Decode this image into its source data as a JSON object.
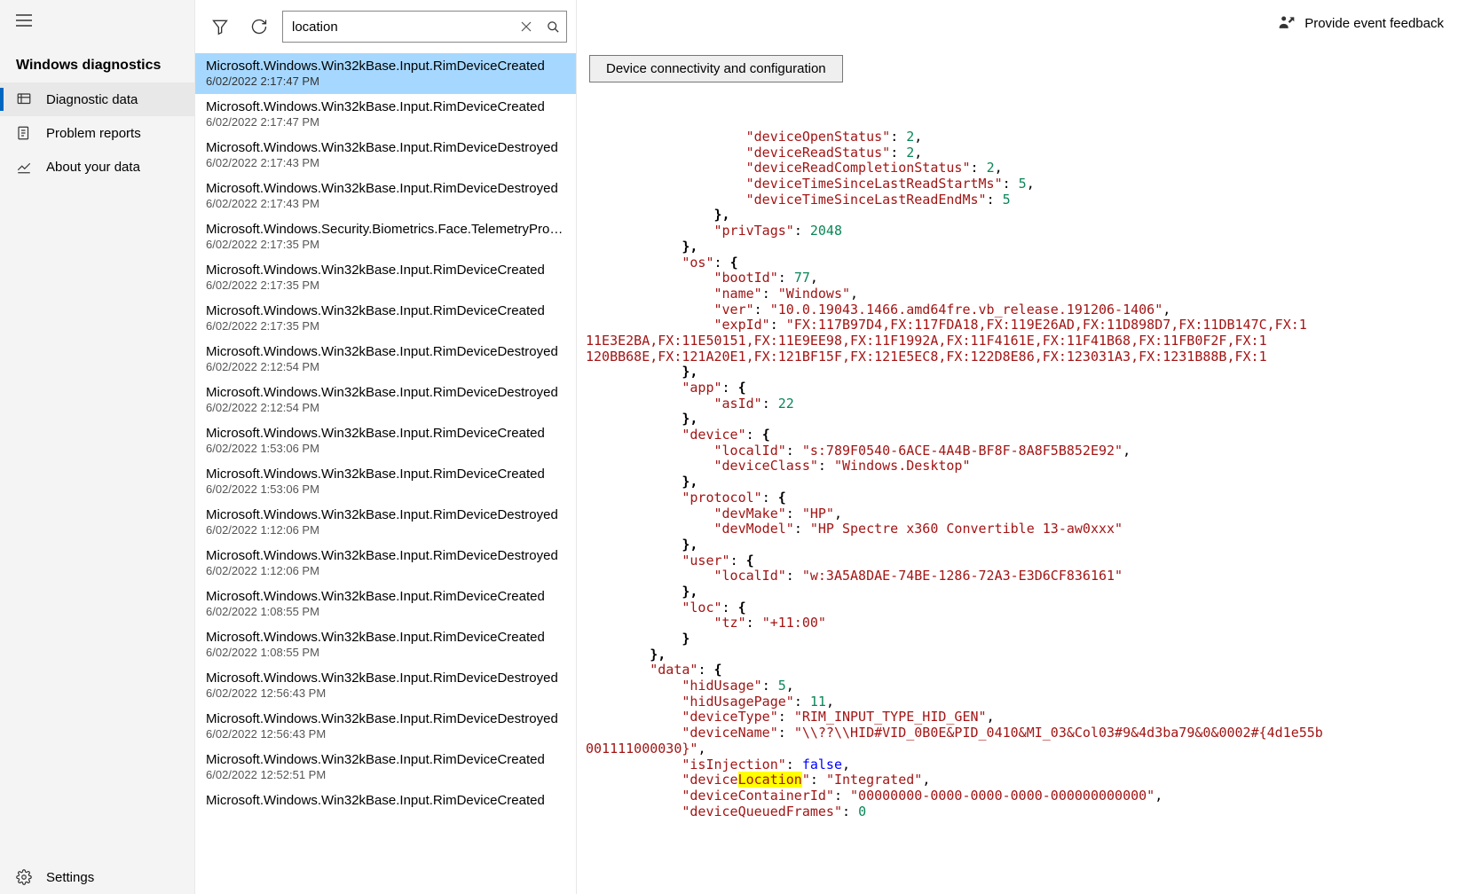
{
  "sidebar": {
    "title": "Windows diagnostics",
    "items": [
      {
        "label": "Diagnostic data",
        "active": true
      },
      {
        "label": "Problem reports",
        "active": false
      },
      {
        "label": "About your data",
        "active": false
      }
    ],
    "settings_label": "Settings"
  },
  "toolbar": {
    "search_value": "location"
  },
  "events": [
    {
      "name": "Microsoft.Windows.Win32kBase.Input.RimDeviceCreated",
      "time": "6/02/2022 2:17:47 PM",
      "selected": true
    },
    {
      "name": "Microsoft.Windows.Win32kBase.Input.RimDeviceCreated",
      "time": "6/02/2022 2:17:47 PM"
    },
    {
      "name": "Microsoft.Windows.Win32kBase.Input.RimDeviceDestroyed",
      "time": "6/02/2022 2:17:43 PM"
    },
    {
      "name": "Microsoft.Windows.Win32kBase.Input.RimDeviceDestroyed",
      "time": "6/02/2022 2:17:43 PM"
    },
    {
      "name": "Microsoft.Windows.Security.Biometrics.Face.TelemetryProvi…",
      "time": "6/02/2022 2:17:35 PM"
    },
    {
      "name": "Microsoft.Windows.Win32kBase.Input.RimDeviceCreated",
      "time": "6/02/2022 2:17:35 PM"
    },
    {
      "name": "Microsoft.Windows.Win32kBase.Input.RimDeviceCreated",
      "time": "6/02/2022 2:17:35 PM"
    },
    {
      "name": "Microsoft.Windows.Win32kBase.Input.RimDeviceDestroyed",
      "time": "6/02/2022 2:12:54 PM"
    },
    {
      "name": "Microsoft.Windows.Win32kBase.Input.RimDeviceDestroyed",
      "time": "6/02/2022 2:12:54 PM"
    },
    {
      "name": "Microsoft.Windows.Win32kBase.Input.RimDeviceCreated",
      "time": "6/02/2022 1:53:06 PM"
    },
    {
      "name": "Microsoft.Windows.Win32kBase.Input.RimDeviceCreated",
      "time": "6/02/2022 1:53:06 PM"
    },
    {
      "name": "Microsoft.Windows.Win32kBase.Input.RimDeviceDestroyed",
      "time": "6/02/2022 1:12:06 PM"
    },
    {
      "name": "Microsoft.Windows.Win32kBase.Input.RimDeviceDestroyed",
      "time": "6/02/2022 1:12:06 PM"
    },
    {
      "name": "Microsoft.Windows.Win32kBase.Input.RimDeviceCreated",
      "time": "6/02/2022 1:08:55 PM"
    },
    {
      "name": "Microsoft.Windows.Win32kBase.Input.RimDeviceCreated",
      "time": "6/02/2022 1:08:55 PM"
    },
    {
      "name": "Microsoft.Windows.Win32kBase.Input.RimDeviceDestroyed",
      "time": "6/02/2022 12:56:43 PM"
    },
    {
      "name": "Microsoft.Windows.Win32kBase.Input.RimDeviceDestroyed",
      "time": "6/02/2022 12:56:43 PM"
    },
    {
      "name": "Microsoft.Windows.Win32kBase.Input.RimDeviceCreated",
      "time": "6/02/2022 12:52:51 PM"
    },
    {
      "name": "Microsoft.Windows.Win32kBase.Input.RimDeviceCreated",
      "time": ""
    }
  ],
  "detail": {
    "category": "Device connectivity and configuration",
    "feedback_label": "Provide event feedback",
    "json_lines": [
      {
        "indent": 10,
        "tokens": [
          {
            "t": "key",
            "v": "\"deviceOpenStatus\""
          },
          {
            "t": "p",
            "v": ": "
          },
          {
            "t": "num",
            "v": "2"
          },
          {
            "t": "p",
            "v": ","
          }
        ]
      },
      {
        "indent": 10,
        "tokens": [
          {
            "t": "key",
            "v": "\"deviceReadStatus\""
          },
          {
            "t": "p",
            "v": ": "
          },
          {
            "t": "num",
            "v": "2"
          },
          {
            "t": "p",
            "v": ","
          }
        ]
      },
      {
        "indent": 10,
        "tokens": [
          {
            "t": "key",
            "v": "\"deviceReadCompletionStatus\""
          },
          {
            "t": "p",
            "v": ": "
          },
          {
            "t": "num",
            "v": "2"
          },
          {
            "t": "p",
            "v": ","
          }
        ]
      },
      {
        "indent": 10,
        "tokens": [
          {
            "t": "key",
            "v": "\"deviceTimeSinceLastReadStartMs\""
          },
          {
            "t": "p",
            "v": ": "
          },
          {
            "t": "num",
            "v": "5"
          },
          {
            "t": "p",
            "v": ","
          }
        ]
      },
      {
        "indent": 10,
        "tokens": [
          {
            "t": "key",
            "v": "\"deviceTimeSinceLastReadEndMs\""
          },
          {
            "t": "p",
            "v": ": "
          },
          {
            "t": "num",
            "v": "5"
          }
        ]
      },
      {
        "indent": 8,
        "tokens": [
          {
            "t": "brace",
            "v": "},"
          }
        ]
      },
      {
        "indent": 8,
        "tokens": [
          {
            "t": "key",
            "v": "\"privTags\""
          },
          {
            "t": "p",
            "v": ": "
          },
          {
            "t": "num",
            "v": "2048"
          }
        ]
      },
      {
        "indent": 6,
        "tokens": [
          {
            "t": "brace",
            "v": "},"
          }
        ]
      },
      {
        "indent": 6,
        "tokens": [
          {
            "t": "key",
            "v": "\"os\""
          },
          {
            "t": "p",
            "v": ": "
          },
          {
            "t": "brace",
            "v": "{"
          }
        ]
      },
      {
        "indent": 8,
        "tokens": [
          {
            "t": "key",
            "v": "\"bootId\""
          },
          {
            "t": "p",
            "v": ": "
          },
          {
            "t": "num",
            "v": "77"
          },
          {
            "t": "p",
            "v": ","
          }
        ]
      },
      {
        "indent": 8,
        "tokens": [
          {
            "t": "key",
            "v": "\"name\""
          },
          {
            "t": "p",
            "v": ": "
          },
          {
            "t": "str",
            "v": "\"Windows\""
          },
          {
            "t": "p",
            "v": ","
          }
        ]
      },
      {
        "indent": 8,
        "tokens": [
          {
            "t": "key",
            "v": "\"ver\""
          },
          {
            "t": "p",
            "v": ": "
          },
          {
            "t": "str",
            "v": "\"10.0.19043.1466.amd64fre.vb_release.191206-1406\""
          },
          {
            "t": "p",
            "v": ","
          }
        ]
      },
      {
        "indent": 8,
        "tokens": [
          {
            "t": "key",
            "v": "\"expId\""
          },
          {
            "t": "p",
            "v": ": "
          },
          {
            "t": "str",
            "v": "\"FX:117B97D4,FX:117FDA18,FX:119E26AD,FX:11D898D7,FX:11DB147C,FX:1"
          }
        ]
      },
      {
        "indent": 0,
        "tokens": [
          {
            "t": "str",
            "v": "11E3E2BA,FX:11E50151,FX:11E9EE98,FX:11F1992A,FX:11F4161E,FX:11F41B68,FX:11FB0F2F,FX:1"
          }
        ]
      },
      {
        "indent": 0,
        "tokens": [
          {
            "t": "str",
            "v": "120BB68E,FX:121A20E1,FX:121BF15F,FX:121E5EC8,FX:122D8E86,FX:123031A3,FX:1231B88B,FX:1"
          }
        ]
      },
      {
        "indent": 6,
        "tokens": [
          {
            "t": "brace",
            "v": "},"
          }
        ]
      },
      {
        "indent": 6,
        "tokens": [
          {
            "t": "key",
            "v": "\"app\""
          },
          {
            "t": "p",
            "v": ": "
          },
          {
            "t": "brace",
            "v": "{"
          }
        ]
      },
      {
        "indent": 8,
        "tokens": [
          {
            "t": "key",
            "v": "\"asId\""
          },
          {
            "t": "p",
            "v": ": "
          },
          {
            "t": "num",
            "v": "22"
          }
        ]
      },
      {
        "indent": 6,
        "tokens": [
          {
            "t": "brace",
            "v": "},"
          }
        ]
      },
      {
        "indent": 6,
        "tokens": [
          {
            "t": "key",
            "v": "\"device\""
          },
          {
            "t": "p",
            "v": ": "
          },
          {
            "t": "brace",
            "v": "{"
          }
        ]
      },
      {
        "indent": 8,
        "tokens": [
          {
            "t": "key",
            "v": "\"localId\""
          },
          {
            "t": "p",
            "v": ": "
          },
          {
            "t": "str",
            "v": "\"s:789F0540-6ACE-4A4B-BF8F-8A8F5B852E92\""
          },
          {
            "t": "p",
            "v": ","
          }
        ]
      },
      {
        "indent": 8,
        "tokens": [
          {
            "t": "key",
            "v": "\"deviceClass\""
          },
          {
            "t": "p",
            "v": ": "
          },
          {
            "t": "str",
            "v": "\"Windows.Desktop\""
          }
        ]
      },
      {
        "indent": 6,
        "tokens": [
          {
            "t": "brace",
            "v": "},"
          }
        ]
      },
      {
        "indent": 6,
        "tokens": [
          {
            "t": "key",
            "v": "\"protocol\""
          },
          {
            "t": "p",
            "v": ": "
          },
          {
            "t": "brace",
            "v": "{"
          }
        ]
      },
      {
        "indent": 8,
        "tokens": [
          {
            "t": "key",
            "v": "\"devMake\""
          },
          {
            "t": "p",
            "v": ": "
          },
          {
            "t": "str",
            "v": "\"HP\""
          },
          {
            "t": "p",
            "v": ","
          }
        ]
      },
      {
        "indent": 8,
        "tokens": [
          {
            "t": "key",
            "v": "\"devModel\""
          },
          {
            "t": "p",
            "v": ": "
          },
          {
            "t": "str",
            "v": "\"HP Spectre x360 Convertible 13-aw0xxx\""
          }
        ]
      },
      {
        "indent": 6,
        "tokens": [
          {
            "t": "brace",
            "v": "},"
          }
        ]
      },
      {
        "indent": 6,
        "tokens": [
          {
            "t": "key",
            "v": "\"user\""
          },
          {
            "t": "p",
            "v": ": "
          },
          {
            "t": "brace",
            "v": "{"
          }
        ]
      },
      {
        "indent": 8,
        "tokens": [
          {
            "t": "key",
            "v": "\"localId\""
          },
          {
            "t": "p",
            "v": ": "
          },
          {
            "t": "str",
            "v": "\"w:3A5A8DAE-74BE-1286-72A3-E3D6CF836161\""
          }
        ]
      },
      {
        "indent": 6,
        "tokens": [
          {
            "t": "brace",
            "v": "},"
          }
        ]
      },
      {
        "indent": 6,
        "tokens": [
          {
            "t": "key",
            "v": "\"loc\""
          },
          {
            "t": "p",
            "v": ": "
          },
          {
            "t": "brace",
            "v": "{"
          }
        ]
      },
      {
        "indent": 8,
        "tokens": [
          {
            "t": "key",
            "v": "\"tz\""
          },
          {
            "t": "p",
            "v": ": "
          },
          {
            "t": "str",
            "v": "\"+11:00\""
          }
        ]
      },
      {
        "indent": 6,
        "tokens": [
          {
            "t": "brace",
            "v": "}"
          }
        ]
      },
      {
        "indent": 4,
        "tokens": [
          {
            "t": "brace",
            "v": "},"
          }
        ]
      },
      {
        "indent": 4,
        "tokens": [
          {
            "t": "key",
            "v": "\"data\""
          },
          {
            "t": "p",
            "v": ": "
          },
          {
            "t": "brace",
            "v": "{"
          }
        ]
      },
      {
        "indent": 6,
        "tokens": [
          {
            "t": "key",
            "v": "\"hidUsage\""
          },
          {
            "t": "p",
            "v": ": "
          },
          {
            "t": "num",
            "v": "5"
          },
          {
            "t": "p",
            "v": ","
          }
        ]
      },
      {
        "indent": 6,
        "tokens": [
          {
            "t": "key",
            "v": "\"hidUsagePage\""
          },
          {
            "t": "p",
            "v": ": "
          },
          {
            "t": "num",
            "v": "11"
          },
          {
            "t": "p",
            "v": ","
          }
        ]
      },
      {
        "indent": 6,
        "tokens": [
          {
            "t": "key",
            "v": "\"deviceType\""
          },
          {
            "t": "p",
            "v": ": "
          },
          {
            "t": "str",
            "v": "\"RIM_INPUT_TYPE_HID_GEN\""
          },
          {
            "t": "p",
            "v": ","
          }
        ]
      },
      {
        "indent": 6,
        "tokens": [
          {
            "t": "key",
            "v": "\"deviceName\""
          },
          {
            "t": "p",
            "v": ": "
          },
          {
            "t": "str",
            "v": "\"\\\\??\\\\HID#VID_0B0E&PID_0410&MI_03&Col03#9&4d3ba79&0&0002#{4d1e55b"
          }
        ]
      },
      {
        "indent": 0,
        "tokens": [
          {
            "t": "str",
            "v": "001111000030}\""
          },
          {
            "t": "p",
            "v": ","
          }
        ]
      },
      {
        "indent": 6,
        "tokens": [
          {
            "t": "key",
            "v": "\"isInjection\""
          },
          {
            "t": "p",
            "v": ": "
          },
          {
            "t": "bool",
            "v": "false"
          },
          {
            "t": "p",
            "v": ","
          }
        ]
      },
      {
        "indent": 6,
        "tokens": [
          {
            "t": "key",
            "v": "\"device"
          },
          {
            "t": "hl",
            "v": "Location"
          },
          {
            "t": "key",
            "v": "\""
          },
          {
            "t": "p",
            "v": ": "
          },
          {
            "t": "str",
            "v": "\"Integrated\""
          },
          {
            "t": "p",
            "v": ","
          }
        ]
      },
      {
        "indent": 6,
        "tokens": [
          {
            "t": "key",
            "v": "\"deviceContainerId\""
          },
          {
            "t": "p",
            "v": ": "
          },
          {
            "t": "str",
            "v": "\"00000000-0000-0000-0000-000000000000\""
          },
          {
            "t": "p",
            "v": ","
          }
        ]
      },
      {
        "indent": 6,
        "tokens": [
          {
            "t": "key",
            "v": "\"deviceQueuedFrames\""
          },
          {
            "t": "p",
            "v": ": "
          },
          {
            "t": "num",
            "v": "0"
          }
        ]
      }
    ]
  }
}
